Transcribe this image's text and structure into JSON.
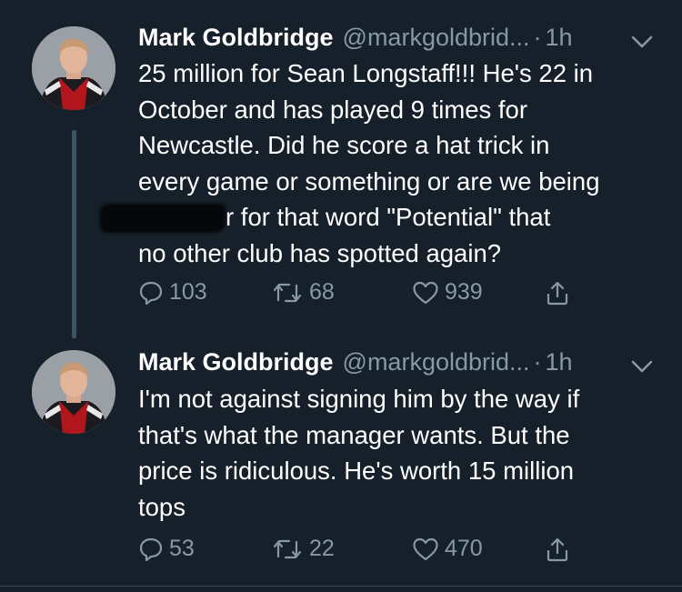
{
  "tweets": [
    {
      "name": "Mark Goldbridge",
      "handle": "@markgoldbrid...",
      "dot": "·",
      "time": "1h",
      "text_line1": "25 million for Sean Longstaff!!! He's 22 in",
      "text_line2": "October and has played 9 times for",
      "text_line3": "Newcastle. Did he score a hat trick in",
      "text_line4": "every game or something or are we being",
      "text_line5_after_redaction": "r for that word \"Potential\" that",
      "text_line6": "no other club has spotted again?",
      "replies": "103",
      "retweets": "68",
      "likes": "939"
    },
    {
      "name": "Mark Goldbridge",
      "handle": "@markgoldbrid...",
      "dot": "·",
      "time": "1h",
      "text_line1": "I'm not against signing him by the way if",
      "text_line2": "that's what the manager wants. But the",
      "text_line3": "price is ridiculous. He's worth 15 million",
      "text_line4": "tops",
      "replies": "53",
      "retweets": "22",
      "likes": "470"
    }
  ],
  "icons": {
    "reply": "reply-icon",
    "retweet": "retweet-icon",
    "like": "heart-icon",
    "share": "share-icon",
    "menu": "chevron-down-icon"
  },
  "colors": {
    "background": "#15202b",
    "text": "#ffffff",
    "muted": "#8899a6",
    "thread_line": "#3d5466"
  }
}
